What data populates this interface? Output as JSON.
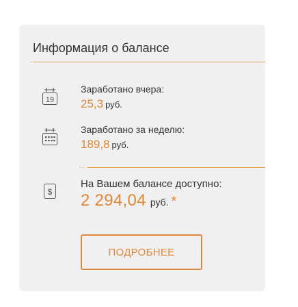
{
  "panel": {
    "title": "Информация о балансе"
  },
  "yesterday": {
    "icon": "calendar-day-icon",
    "icon_day": "19",
    "label": "Заработано вчера:",
    "value": "25,3",
    "unit": "руб."
  },
  "week": {
    "icon": "calendar-week-icon",
    "label": "Заработано за неделю:",
    "value": "189,8",
    "unit": "руб."
  },
  "balance": {
    "icon": "dollar-icon",
    "icon_symbol": "$",
    "label": "На Вашем балансе доступно:",
    "value": "2 294,04",
    "unit": "руб.",
    "note_mark": "*"
  },
  "actions": {
    "details_label": "ПОДРОБНЕЕ"
  },
  "colors": {
    "accent": "#e0883a",
    "divider": "#e4a24b",
    "panel_bg": "#f0f0f0",
    "text": "#333333"
  }
}
